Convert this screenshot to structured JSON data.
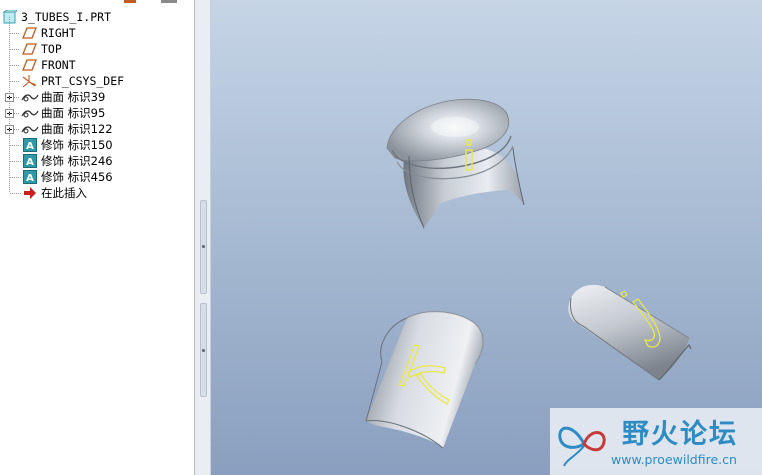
{
  "model_tree": {
    "root": "3_TUBES_I.PRT",
    "items": [
      {
        "label": "RIGHT",
        "icon": "datum-plane-icon",
        "expandable": false
      },
      {
        "label": "TOP",
        "icon": "datum-plane-icon",
        "expandable": false
      },
      {
        "label": "FRONT",
        "icon": "datum-plane-icon",
        "expandable": false
      },
      {
        "label": "PRT_CSYS_DEF",
        "icon": "coordinate-system-icon",
        "expandable": false
      },
      {
        "label": "曲面 标识39",
        "icon": "surface-icon",
        "expandable": true
      },
      {
        "label": "曲面 标识95",
        "icon": "surface-icon",
        "expandable": true
      },
      {
        "label": "曲面 标识122",
        "icon": "surface-icon",
        "expandable": true
      },
      {
        "label": "修饰 标识150",
        "icon": "cosmetic-feature-icon",
        "expandable": false
      },
      {
        "label": "修饰 标识246",
        "icon": "cosmetic-feature-icon",
        "expandable": false
      },
      {
        "label": "修饰 标识456",
        "icon": "cosmetic-feature-icon",
        "expandable": false
      },
      {
        "label": "在此插入",
        "icon": "insert-here-arrow-icon",
        "expandable": false
      }
    ]
  },
  "viewport": {
    "letters": [
      "i",
      "k",
      "j"
    ],
    "letter_color": "#e8e84a"
  },
  "watermark": {
    "brand": "野火论坛",
    "url": "www.proewildfire.cn"
  },
  "colors": {
    "accent": "#2e8bc4",
    "datum": "#c25b22",
    "insert_arrow": "#c81e1e"
  }
}
